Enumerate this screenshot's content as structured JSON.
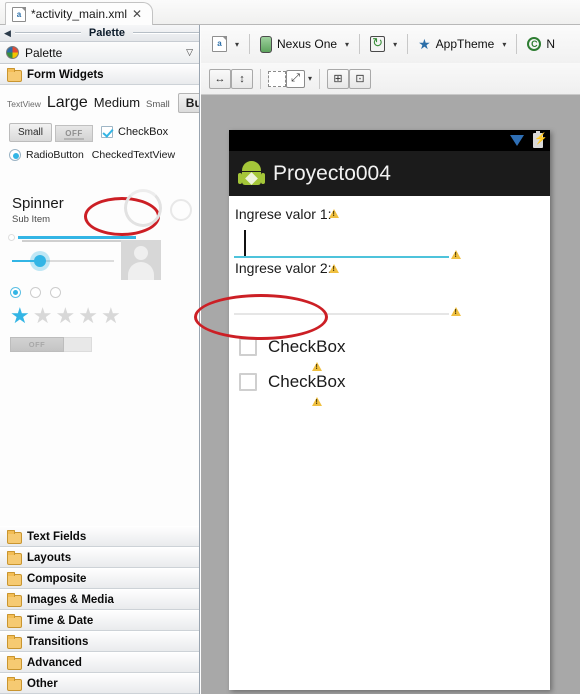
{
  "window": {
    "tab": {
      "label": "*activity_main.xml",
      "close": "✕",
      "icon": "xml-file-icon"
    }
  },
  "palette": {
    "titlebar": {
      "text": "Palette",
      "collapse_arrow": "◀"
    },
    "header": {
      "title": "Palette",
      "chevron": "▽",
      "icon": "palette-icon"
    },
    "group": {
      "label": "Form Widgets",
      "icon": "folder-icon"
    },
    "widgets": {
      "textview": "TextView",
      "large": "Large",
      "medium": "Medium",
      "small": "Small",
      "button": "Button",
      "small_button": "Small",
      "off_button": "OFF",
      "checkbox": "CheckBox",
      "radiobutton": "RadioButton",
      "checkedtextview": "CheckedTextView",
      "spinner": "Spinner",
      "spinner_sub": "Sub Item",
      "switch_off": "OFF"
    },
    "stars": [
      "★",
      "★",
      "★",
      "★",
      "★"
    ],
    "categories": [
      {
        "label": "Text Fields"
      },
      {
        "label": "Layouts"
      },
      {
        "label": "Composite"
      },
      {
        "label": "Images & Media"
      },
      {
        "label": "Time & Date"
      },
      {
        "label": "Transitions"
      },
      {
        "label": "Advanced"
      },
      {
        "label": "Other"
      }
    ]
  },
  "toolbar": {
    "config_icon": "layout-config-icon",
    "device": "Nexus One",
    "device_icon": "device-icon",
    "orientation_icon": "orientation-icon",
    "theme": "AppTheme",
    "theme_icon": "theme-star-icon",
    "locale_icon": "globe-icon",
    "locale_label": "N",
    "caret": "▾",
    "row2": {
      "width_icon": "↔",
      "height_icon": "↕",
      "margins_icon": "dashed-box-icon",
      "expand_icon": "⤢",
      "caret": "▾",
      "align_icon": "align-baseline-icon",
      "distribute_icon": "distribute-icon"
    }
  },
  "preview": {
    "app_title": "Proyecto004",
    "app_icon": "android-robot-icon",
    "statusbar": {
      "download_icon": "download-triangle-icon",
      "battery_icon": "battery-charging-icon"
    },
    "label1": "Ingrese valor 1:",
    "label2": "Ingrese valor 2:",
    "checkbox1": "CheckBox",
    "checkbox2": "CheckBox",
    "warning_icon": "warning-triangle-icon"
  },
  "colors": {
    "accent_cyan": "#33b5e5",
    "edit_focused": "#4ec3db",
    "edit_normal": "#e6e6e6",
    "annotation_red": "#cc1f25",
    "android_green": "#a4c639",
    "canvas_gray": "#a8a8a8",
    "actionbar": "#1b1b1b"
  }
}
